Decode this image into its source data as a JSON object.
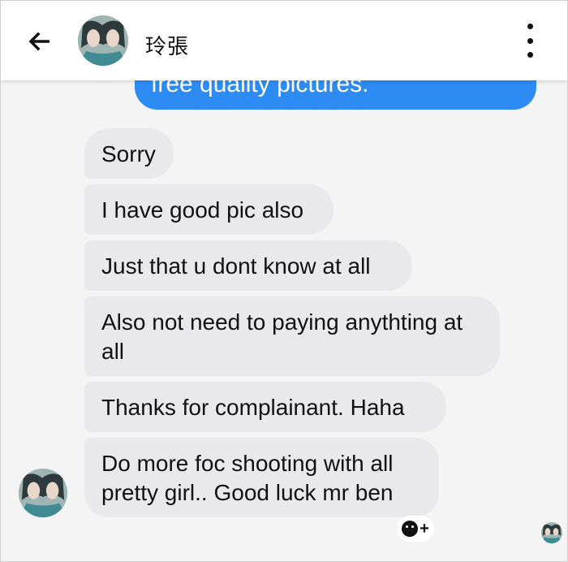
{
  "header": {
    "back_icon": "arrow-left-icon",
    "contact_name": "玲張",
    "menu_icon": "more-vertical-icon"
  },
  "conversation": {
    "outgoing_partial": "free quality pictures.",
    "incoming": [
      "Sorry",
      "I have good pic also",
      "Just that u dont know at all",
      "Also not need to paying anythting at all",
      "Thanks for complainant. Haha",
      "Do more foc shooting with all pretty girl.. Good luck mr ben"
    ]
  },
  "reaction": {
    "icon": "add-reaction-icon",
    "plus": "+"
  },
  "colors": {
    "outgoing_bubble": "#2c8cf4",
    "incoming_bubble": "#e9e9eb",
    "background": "#f4f4f4",
    "header": "#ffffff"
  }
}
